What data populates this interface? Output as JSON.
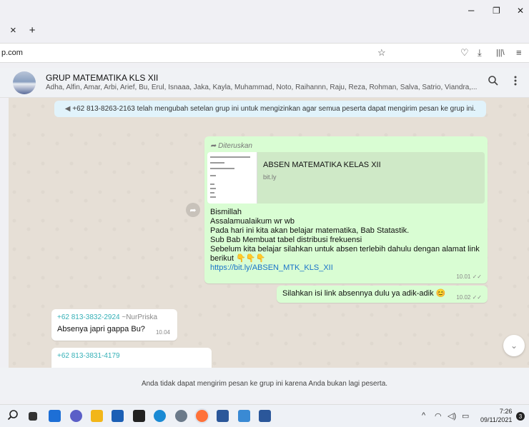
{
  "browser": {
    "tab_close": "×",
    "tab_new": "+",
    "win_minimize": "–",
    "win_restore": "❐",
    "win_close": "✕",
    "url": "p.com",
    "icons": [
      "star-icon",
      "pocket-icon",
      "download-icon",
      "library-icon",
      "menu-icon"
    ]
  },
  "header": {
    "title": "GRUP MATEMATIKA KLS XII",
    "members": "Adha, Alfin, Amar, Arbi, Arief, Bu, Erul, Isnaaa, Jaka, Kayla, Muhammad, Noto, Raihannn, Raju, Reza, Rohman, Salva, Satrio, Viandra,..."
  },
  "chat": {
    "system_message": "+62 813-8263-2163 telah mengubah setelan grup ini untuk mengizinkan agar semua peserta dapat mengirim pesan ke grup ini.",
    "forwarded": {
      "label": "Diteruskan",
      "link_title": "ABSEN MATEMATIKA KELAS XII",
      "link_domain": "bit.ly",
      "lines": [
        "Bismillah",
        "Assalamualaikum wr wb",
        "Pada hari ini kita akan belajar matematika, Bab Statastik.",
        "Sub Bab Membuat tabel distribusi frekuensi",
        "Sebelum kita belajar silahkan untuk absen terlebih dahulu dengan alamat link",
        "berikut 👇👇👇"
      ],
      "link": "https://bit.ly/ABSEN_MTK_KLS_XII",
      "time": "10.01 ✓✓"
    },
    "reply": {
      "text": "Silahkan isi link absennya dulu ya adik-adik 😊",
      "time": "10.02 ✓✓"
    },
    "incoming1": {
      "sender": "+62 813-3832-2924",
      "sender_name": "~NurPriska",
      "text": "Absenya japri gappa Bu?",
      "time": "10.04"
    },
    "incoming2": {
      "sender": "+62 813-3831-4179"
    }
  },
  "footer": {
    "notice": "Anda tidak dapat mengirim pesan ke grup ini karena Anda bukan lagi peserta."
  },
  "taskbar": {
    "time": "7:26",
    "date": "09/11/2021",
    "notifications": "3",
    "tray_chevron": "^"
  }
}
